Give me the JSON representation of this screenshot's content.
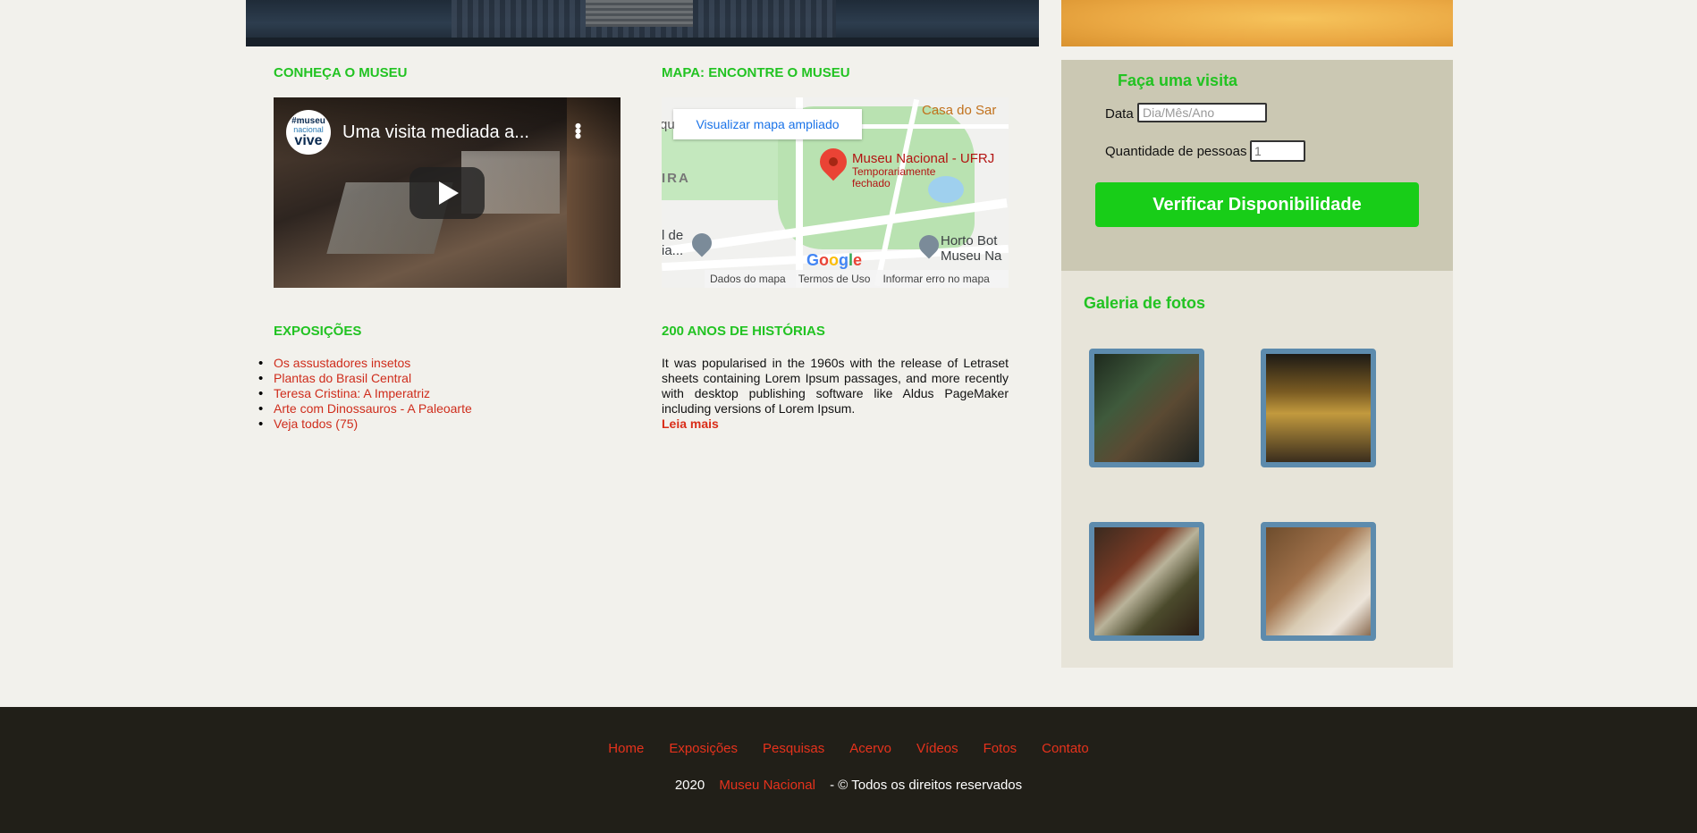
{
  "sections": {
    "museum_title": "CONHEÇA O MUSEU",
    "map_title": "MAPA: ENCONTRE O MUSEU",
    "exhibitions_title": "EXPOSIÇÕES",
    "history_title": "200 ANOS DE HISTÓRIAS"
  },
  "video": {
    "title": "Uma visita mediada a...",
    "channel_line1": "#museu",
    "channel_line2": "nacional",
    "channel_line3": "vive",
    "icons": [
      "kebab-icon",
      "play-icon"
    ]
  },
  "map": {
    "view_larger": "Visualizar mapa ampliado",
    "place_name": "Museu Nacional - UFRJ",
    "place_status": "Temporariamente fechado",
    "label_casa": "Casa do Sar",
    "label_qu": "qu",
    "label_ira": "IRA",
    "label_de": "l de",
    "label_ia": "ia...",
    "label_horto": "Horto Bot",
    "label_museu_na": "Museu Na",
    "map_data": "Dados do mapa",
    "terms": "Termos de Uso",
    "report": "Informar erro no mapa",
    "google_letters": [
      "G",
      "o",
      "o",
      "g",
      "l",
      "e"
    ]
  },
  "exhibitions": [
    "Os assustadores insetos",
    "Plantas do Brasil Central",
    "Teresa Cristina: A Imperatriz",
    "Arte com Dinossauros - A Paleoarte",
    "Veja todos (75)"
  ],
  "history": {
    "text": "It was popularised in the 1960s with the release of Letraset sheets containing Lorem Ipsum passages, and more recently with desktop publishing software like Aldus PageMaker including versions of Lorem Ipsum.",
    "read_more": "Leia mais"
  },
  "visit": {
    "title": "Faça uma visita",
    "date_label": "Data",
    "date_placeholder": "Dia/Mês/Ano",
    "qty_label": "Quantidade de pessoas",
    "qty_value": "1",
    "button": "Verificar Disponibilidade"
  },
  "gallery": {
    "title": "Galeria de fotos"
  },
  "footer": {
    "nav": [
      "Home",
      "Exposições",
      "Pesquisas",
      "Acervo",
      "Vídeos",
      "Fotos",
      "Contato"
    ],
    "year": "2020",
    "brand": "Museu Nacional",
    "rights": "- © Todos os direitos reservados"
  },
  "colors": {
    "accent_green": "#22c322",
    "link_red": "#cf2d1c",
    "button_green": "#18cd18",
    "footer_bg": "#211f18"
  }
}
